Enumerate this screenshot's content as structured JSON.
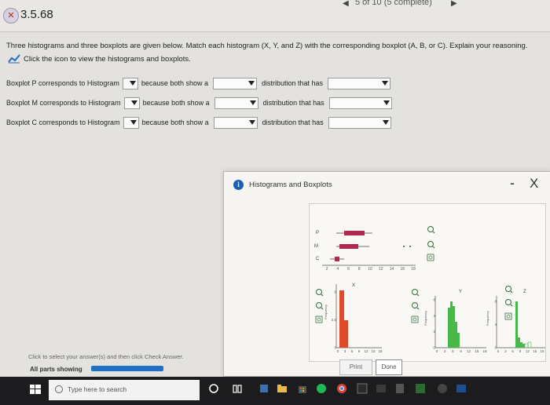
{
  "header": {
    "question_number": "3.5.68",
    "progress": "5 of 10 (5 complete)"
  },
  "instructions": "Three histograms and three boxplots are given below. Match each histogram (X, Y, and Z) with the corresponding boxplot (A, B, or C). Explain your reasoning.",
  "view_link": "Click the icon to view the histograms and boxplots.",
  "rows": [
    {
      "prefix": "Boxplot P corresponds to Histogram",
      "mid": "because both show a",
      "suffix": "distribution that has"
    },
    {
      "prefix": "Boxplot M corresponds to Histogram",
      "mid": "because both show a",
      "suffix": "distribution that has"
    },
    {
      "prefix": "Boxplot C corresponds to Histogram",
      "mid": "because both show a",
      "suffix": "distribution that has"
    }
  ],
  "popup": {
    "title": "Histograms and Boxplots",
    "minimize": "-",
    "close": "X"
  },
  "boxplots": {
    "labels": [
      "P",
      "M",
      "C"
    ],
    "axis_ticks": [
      "2",
      "4",
      "6",
      "8",
      "10",
      "12",
      "14",
      "16",
      "18"
    ]
  },
  "histograms": [
    {
      "name": "X",
      "y_ticks": [
        "0",
        "2.5",
        "5"
      ],
      "x_ticks": [
        "0",
        "3",
        "6",
        "9",
        "12",
        "15",
        "18"
      ],
      "ylabel": "Frequency"
    },
    {
      "name": "Y",
      "y_ticks": [
        "0",
        "2",
        "4",
        "6"
      ],
      "x_ticks": [
        "0",
        "3",
        "6",
        "9",
        "12",
        "15",
        "18"
      ],
      "ylabel": "Frequency"
    },
    {
      "name": "Z",
      "y_ticks": [
        "0",
        "4",
        "8"
      ],
      "x_ticks": [
        "0",
        "3",
        "6",
        "9",
        "12",
        "15",
        "18"
      ],
      "ylabel": "Frequency"
    }
  ],
  "footer": {
    "hint": "Click to select your answer(s) and then click Check Answer.",
    "parts": "All parts showing",
    "print": "Print",
    "done": "Done"
  },
  "taskbar": {
    "search_placeholder": "Type here to search"
  },
  "colors": {
    "accent": "#1f6fc7",
    "histogram_bar": "#e04a2a",
    "histogram_bar2": "#48b84a",
    "box_fill": "#c0305a",
    "taskbar": "#1c1c1e"
  }
}
